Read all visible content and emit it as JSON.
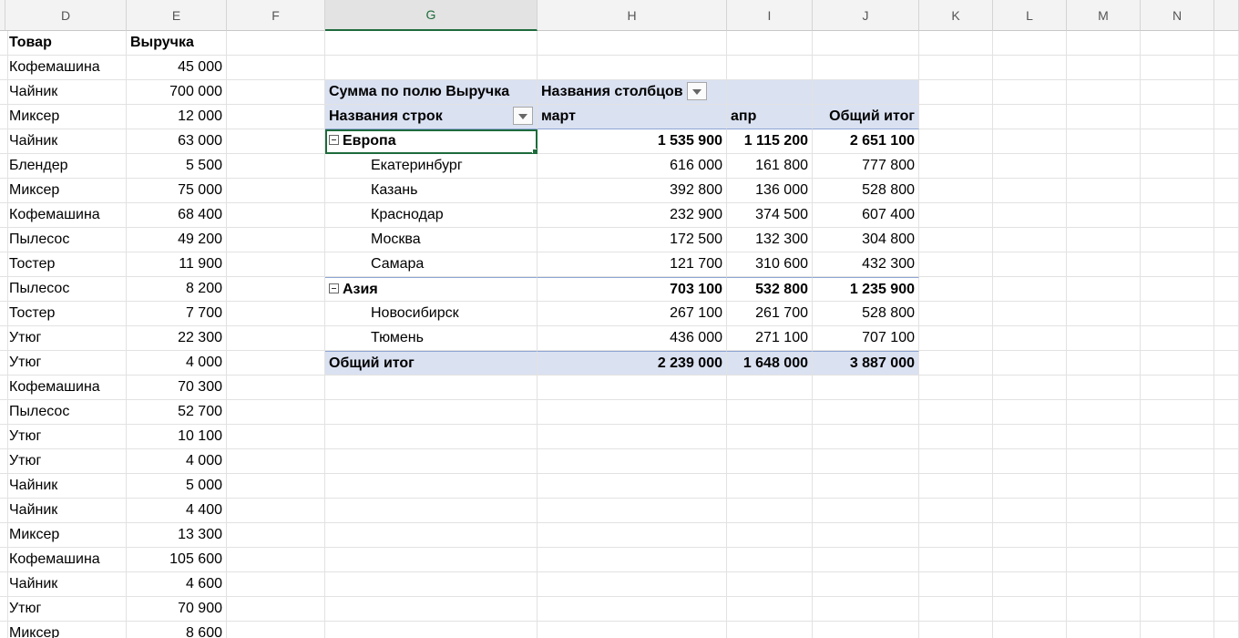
{
  "columns": [
    "D",
    "E",
    "F",
    "G",
    "H",
    "I",
    "J",
    "K",
    "L",
    "M",
    "N"
  ],
  "selected_column": "G",
  "source_table": {
    "header": {
      "product": "Товар",
      "revenue": "Выручка"
    },
    "rows": [
      {
        "product": "Кофемашина",
        "revenue": "45 000"
      },
      {
        "product": "Чайник",
        "revenue": "700 000"
      },
      {
        "product": "Миксер",
        "revenue": "12 000"
      },
      {
        "product": "Чайник",
        "revenue": "63 000"
      },
      {
        "product": "Блендер",
        "revenue": "5 500"
      },
      {
        "product": "Миксер",
        "revenue": "75 000"
      },
      {
        "product": "Кофемашина",
        "revenue": "68 400"
      },
      {
        "product": "Пылесос",
        "revenue": "49 200"
      },
      {
        "product": "Тостер",
        "revenue": "11 900"
      },
      {
        "product": "Пылесос",
        "revenue": "8 200"
      },
      {
        "product": "Тостер",
        "revenue": "7 700"
      },
      {
        "product": "Утюг",
        "revenue": "22 300"
      },
      {
        "product": "Утюг",
        "revenue": "4 000"
      },
      {
        "product": "Кофемашина",
        "revenue": "70 300"
      },
      {
        "product": "Пылесос",
        "revenue": "52 700"
      },
      {
        "product": "Утюг",
        "revenue": "10 100"
      },
      {
        "product": "Утюг",
        "revenue": "4 000"
      },
      {
        "product": "Чайник",
        "revenue": "5 000"
      },
      {
        "product": "Чайник",
        "revenue": "4 400"
      },
      {
        "product": "Миксер",
        "revenue": "13 300"
      },
      {
        "product": "Кофемашина",
        "revenue": "105 600"
      },
      {
        "product": "Чайник",
        "revenue": "4 600"
      },
      {
        "product": "Утюг",
        "revenue": "70 900"
      },
      {
        "product": "Миксер",
        "revenue": "8 600"
      }
    ]
  },
  "pivot": {
    "value_field": "Сумма по полю Выручка",
    "column_labels": "Названия столбцов",
    "row_labels": "Названия строк",
    "col_march": "март",
    "col_april": "апр",
    "col_total": "Общий итог",
    "groups": [
      {
        "name": "Европа",
        "march": "1 535 900",
        "april": "1 115 200",
        "total": "2 651 100",
        "cities": [
          {
            "name": "Екатеринбург",
            "march": "616 000",
            "april": "161 800",
            "total": "777 800"
          },
          {
            "name": "Казань",
            "march": "392 800",
            "april": "136 000",
            "total": "528 800"
          },
          {
            "name": "Краснодар",
            "march": "232 900",
            "april": "374 500",
            "total": "607 400"
          },
          {
            "name": "Москва",
            "march": "172 500",
            "april": "132 300",
            "total": "304 800"
          },
          {
            "name": "Самара",
            "march": "121 700",
            "april": "310 600",
            "total": "432 300"
          }
        ]
      },
      {
        "name": "Азия",
        "march": "703 100",
        "april": "532 800",
        "total": "1 235 900",
        "cities": [
          {
            "name": "Новосибирск",
            "march": "267 100",
            "april": "261 700",
            "total": "528 800"
          },
          {
            "name": "Тюмень",
            "march": "436 000",
            "april": "271 100",
            "total": "707 100"
          }
        ]
      }
    ],
    "grand_total": {
      "label": "Общий итог",
      "march": "2 239 000",
      "april": "1 648 000",
      "total": "3 887 000"
    }
  },
  "colors": {
    "pivot_header_fill": "#dae1f1",
    "pivot_line": "#8ea6d4",
    "selection_green": "#1e6b3c",
    "grid_line": "#e2e2e2",
    "header_bg": "#f3f3f3"
  }
}
